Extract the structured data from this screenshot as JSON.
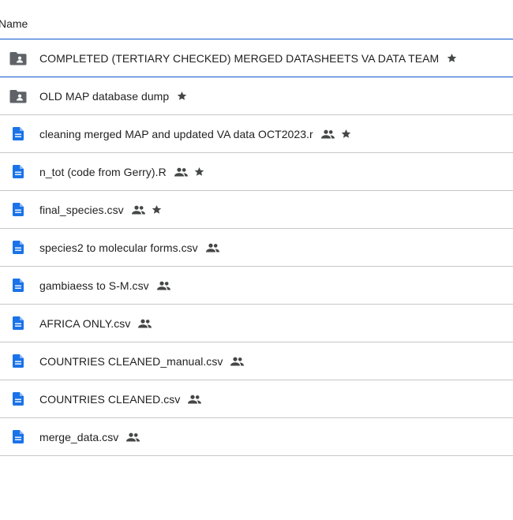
{
  "header": {
    "name_label": "Name"
  },
  "colors": {
    "accent": "#0b57d0",
    "folder": "#5f6368",
    "doc": "#1a73e8",
    "star": "#444746",
    "shared": "#444746",
    "divider": "#c7c7c7"
  },
  "files": [
    {
      "name": "COMPLETED (TERTIARY CHECKED) MERGED DATASHEETS VA DATA TEAM",
      "type": "shared-folder",
      "icon": "shared-folder-icon",
      "shared": false,
      "starred": true,
      "selected": true
    },
    {
      "name": "OLD MAP database dump",
      "type": "shared-folder",
      "icon": "shared-folder-icon",
      "shared": false,
      "starred": true,
      "selected": false
    },
    {
      "name": "cleaning merged MAP and updated VA data OCT2023.r",
      "type": "file",
      "icon": "document-icon",
      "shared": true,
      "starred": true,
      "selected": false
    },
    {
      "name": "n_tot (code from Gerry).R",
      "type": "file",
      "icon": "document-icon",
      "shared": true,
      "starred": true,
      "selected": false
    },
    {
      "name": "final_species.csv",
      "type": "file",
      "icon": "document-icon",
      "shared": true,
      "starred": true,
      "selected": false
    },
    {
      "name": "species2 to molecular forms.csv",
      "type": "file",
      "icon": "document-icon",
      "shared": true,
      "starred": false,
      "selected": false
    },
    {
      "name": "gambiaess to S-M.csv",
      "type": "file",
      "icon": "document-icon",
      "shared": true,
      "starred": false,
      "selected": false
    },
    {
      "name": "AFRICA ONLY.csv",
      "type": "file",
      "icon": "document-icon",
      "shared": true,
      "starred": false,
      "selected": false
    },
    {
      "name": "COUNTRIES CLEANED_manual.csv",
      "type": "file",
      "icon": "document-icon",
      "shared": true,
      "starred": false,
      "selected": false
    },
    {
      "name": "COUNTRIES CLEANED.csv",
      "type": "file",
      "icon": "document-icon",
      "shared": true,
      "starred": false,
      "selected": false
    },
    {
      "name": "merge_data.csv",
      "type": "file",
      "icon": "document-icon",
      "shared": true,
      "starred": false,
      "selected": false
    }
  ]
}
